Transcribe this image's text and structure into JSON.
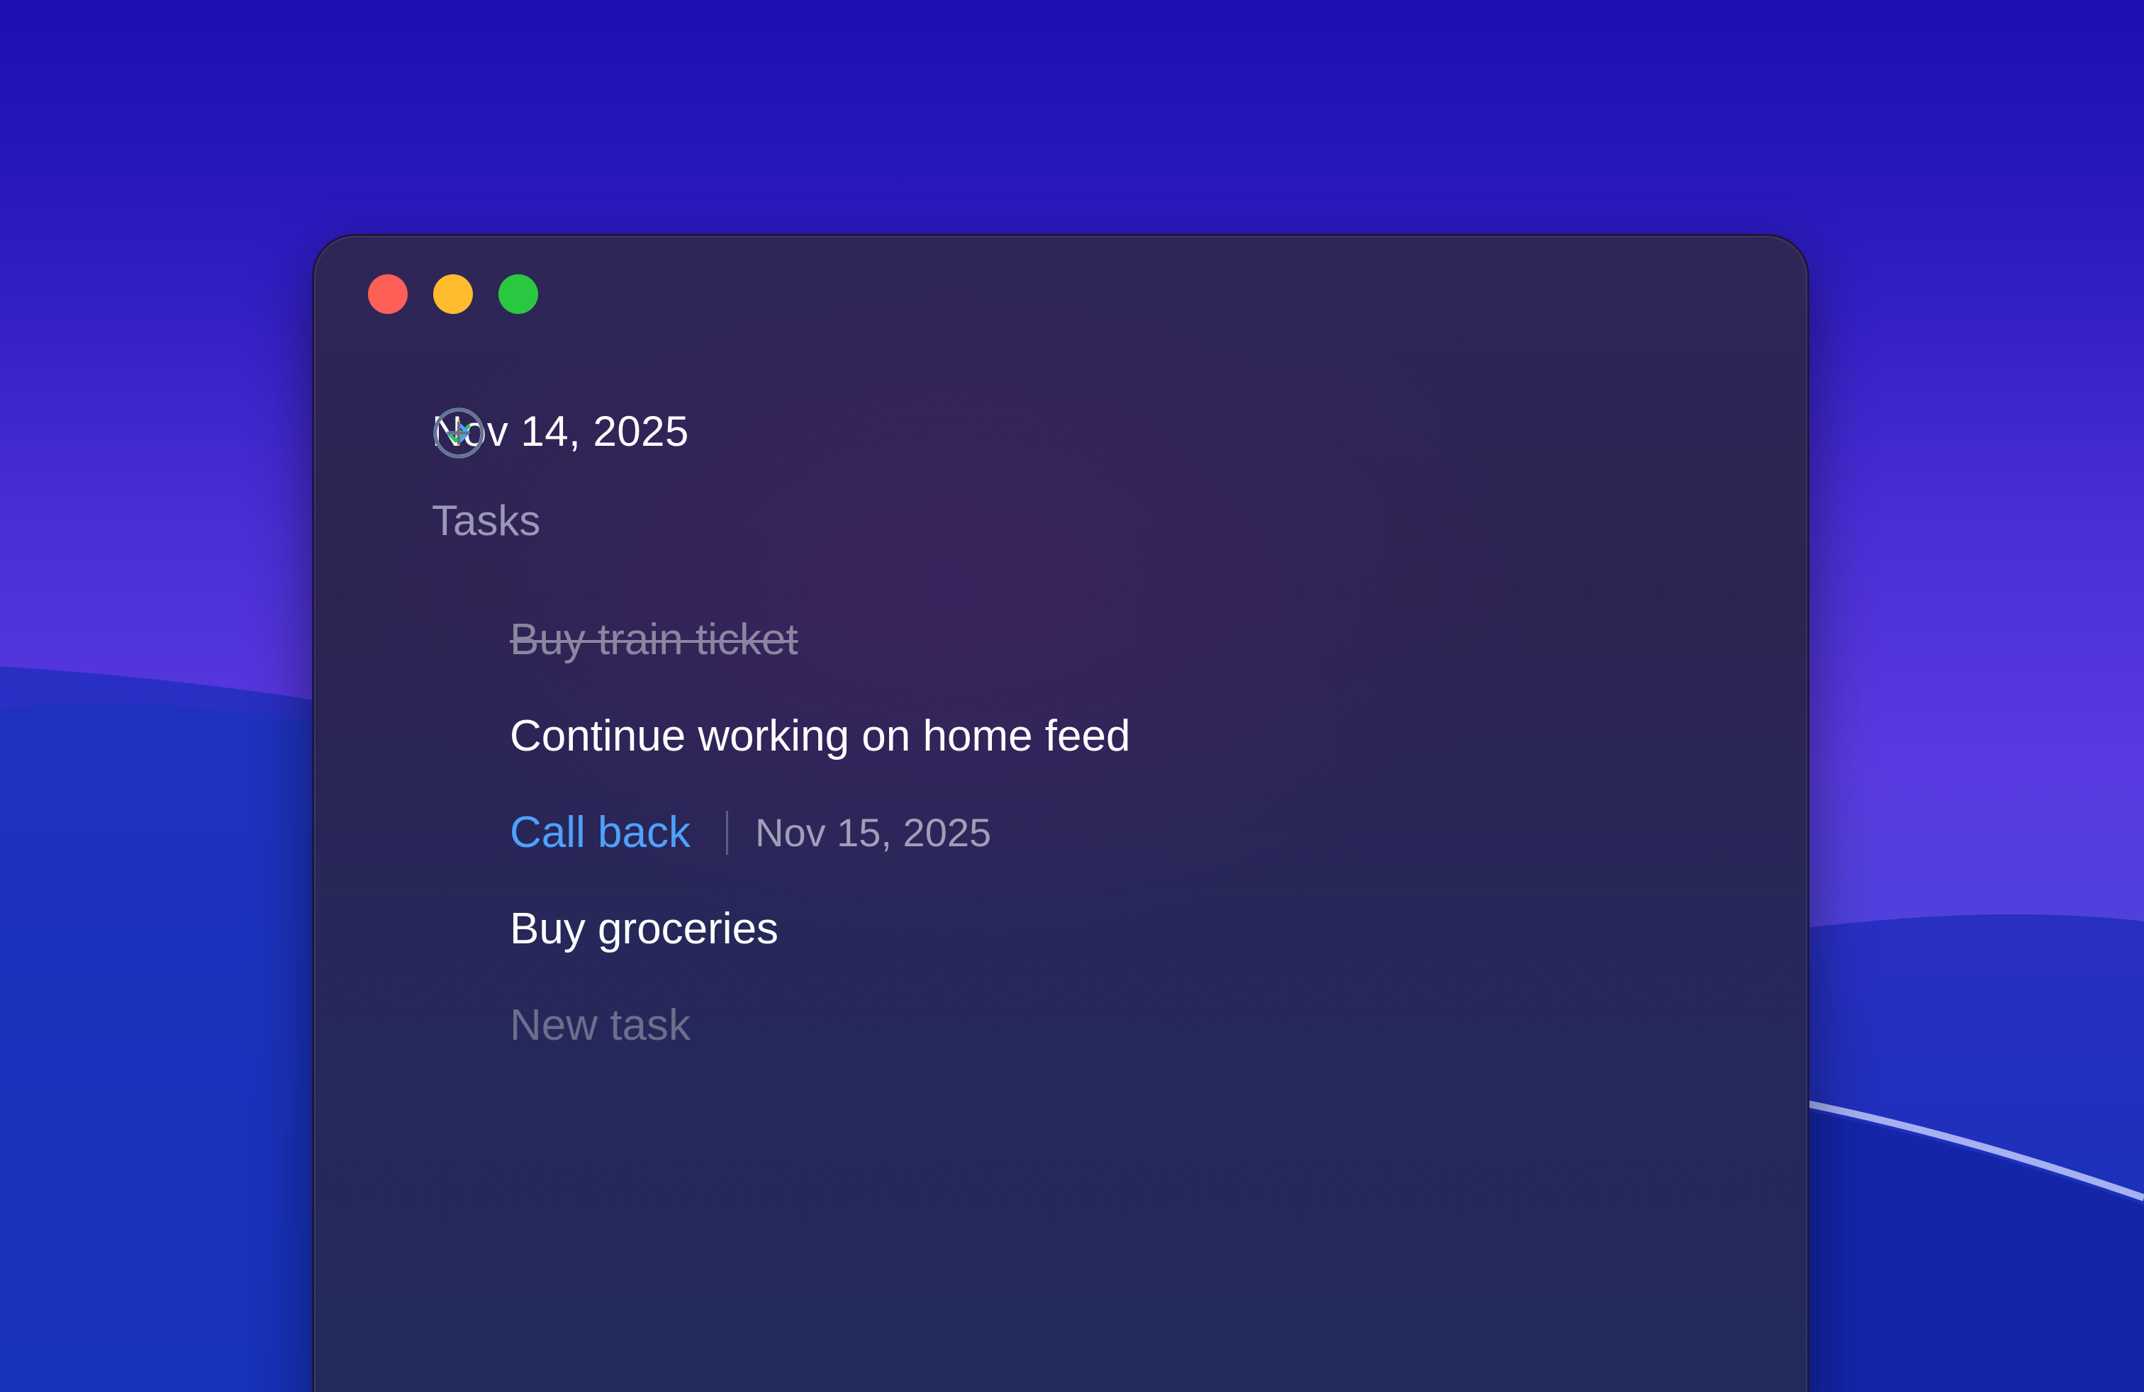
{
  "window": {
    "traffic_lights": [
      "close",
      "minimize",
      "zoom"
    ]
  },
  "header": {
    "date": "Nov 14, 2025",
    "section": "Tasks"
  },
  "tasks": [
    {
      "label": "Buy train ticket",
      "status": "completed",
      "icon": "check-circle-icon",
      "color": "#22c55e"
    },
    {
      "label": "Continue working on home feed",
      "status": "in-progress",
      "icon": "in-progress-icon",
      "color": "#f5b800"
    },
    {
      "label": "Call back",
      "status": "scheduled",
      "icon": "arrow-right-circle-icon",
      "color": "#4ea1ff",
      "due_date": "Nov 15, 2025"
    },
    {
      "label": "Buy groceries",
      "status": "todo",
      "icon": "dashed-circle-icon",
      "color": "#c8c6d8"
    }
  ],
  "new_task": {
    "label": "New task",
    "icon": "plus-circle-icon"
  },
  "colors": {
    "accent": "#4ea1ff",
    "completed": "#22c55e",
    "in_progress": "#f5b800",
    "close": "#fe5f57",
    "minimize": "#febb2e",
    "zoom": "#29c840"
  }
}
